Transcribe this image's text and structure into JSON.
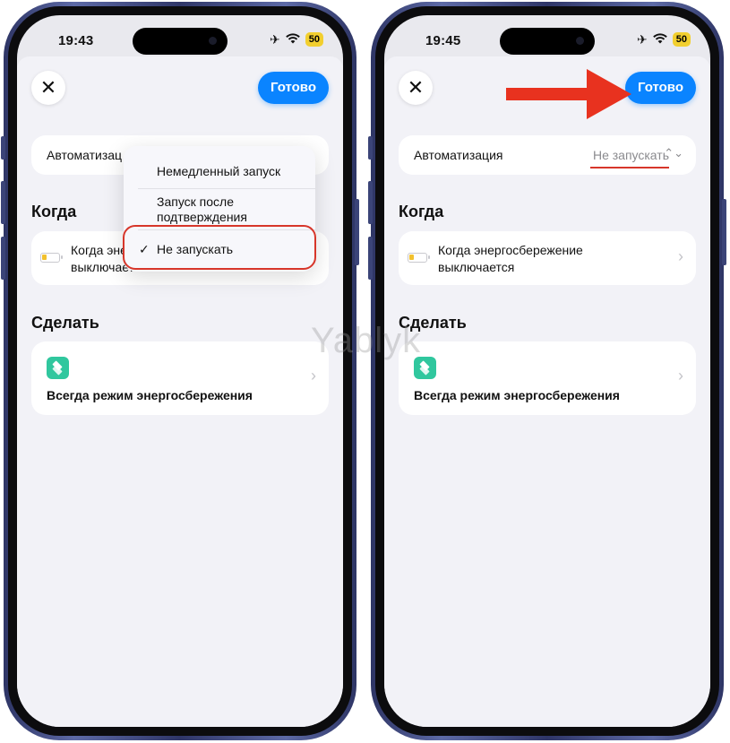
{
  "left": {
    "status": {
      "time": "19:43",
      "battery": "50"
    },
    "toolbar": {
      "done_label": "Готово"
    },
    "automation": {
      "label": "Автоматизац"
    },
    "menu": {
      "items": [
        "Немедленный запуск",
        "Запуск после подтверждения",
        "Не запускать"
      ],
      "selected": "Не запускать"
    },
    "when": {
      "title": "Когда",
      "trigger_text": "Когда энергосбережение выключается"
    },
    "do": {
      "title": "Сделать",
      "action_text": "Всегда режим энергосбережения"
    }
  },
  "right": {
    "status": {
      "time": "19:45",
      "battery": "50"
    },
    "toolbar": {
      "done_label": "Готово"
    },
    "automation": {
      "label": "Автоматизация",
      "value": "Не запускать"
    },
    "when": {
      "title": "Когда",
      "trigger_text": "Когда энергосбережение выключается"
    },
    "do": {
      "title": "Сделать",
      "action_text": "Всегда режим энергосбережения"
    }
  },
  "watermark": "Yablyk",
  "icons": [
    "close-icon",
    "airplane-icon",
    "wifi-icon",
    "battery-icon",
    "checkmark-icon",
    "chevron-right-icon",
    "up-down-chevron-icon",
    "layers-icon",
    "arrow-icon"
  ],
  "colors": {
    "accent": "#0a84ff",
    "annotation": "#d7362a",
    "action_icon": "#30c79e",
    "battery": "#f2cf2f"
  }
}
